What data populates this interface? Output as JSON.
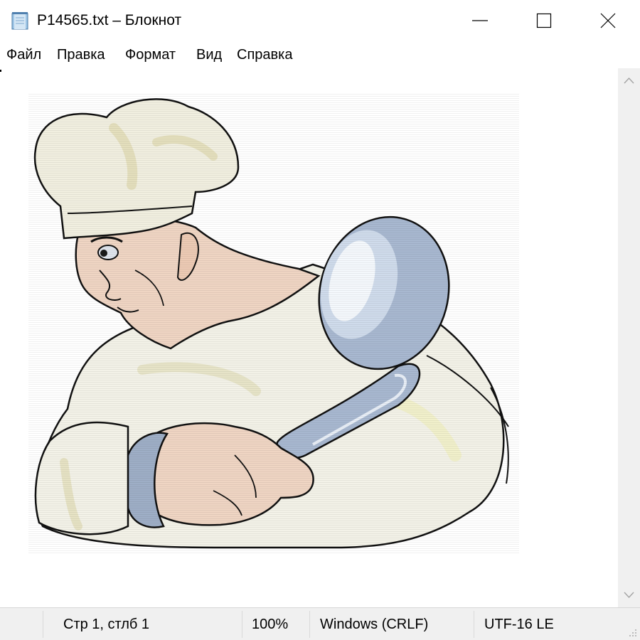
{
  "window": {
    "title": "P14565.txt – Блокнот",
    "icon": "notepad-icon"
  },
  "menu": {
    "items": [
      "Файл",
      "Правка",
      "Формат",
      "Вид",
      "Справка"
    ]
  },
  "editor": {
    "content": "chef-with-ladle-ascii-art",
    "colors": {
      "hat": "#f1efe0",
      "skin": "#efd5c3",
      "ladle": "#a8b8d0",
      "outline": "#1a1a1a"
    }
  },
  "status": {
    "position": "Стр 1, стлб 1",
    "zoom": "100%",
    "line_ending": "Windows (CRLF)",
    "encoding": "UTF-16 LE"
  }
}
